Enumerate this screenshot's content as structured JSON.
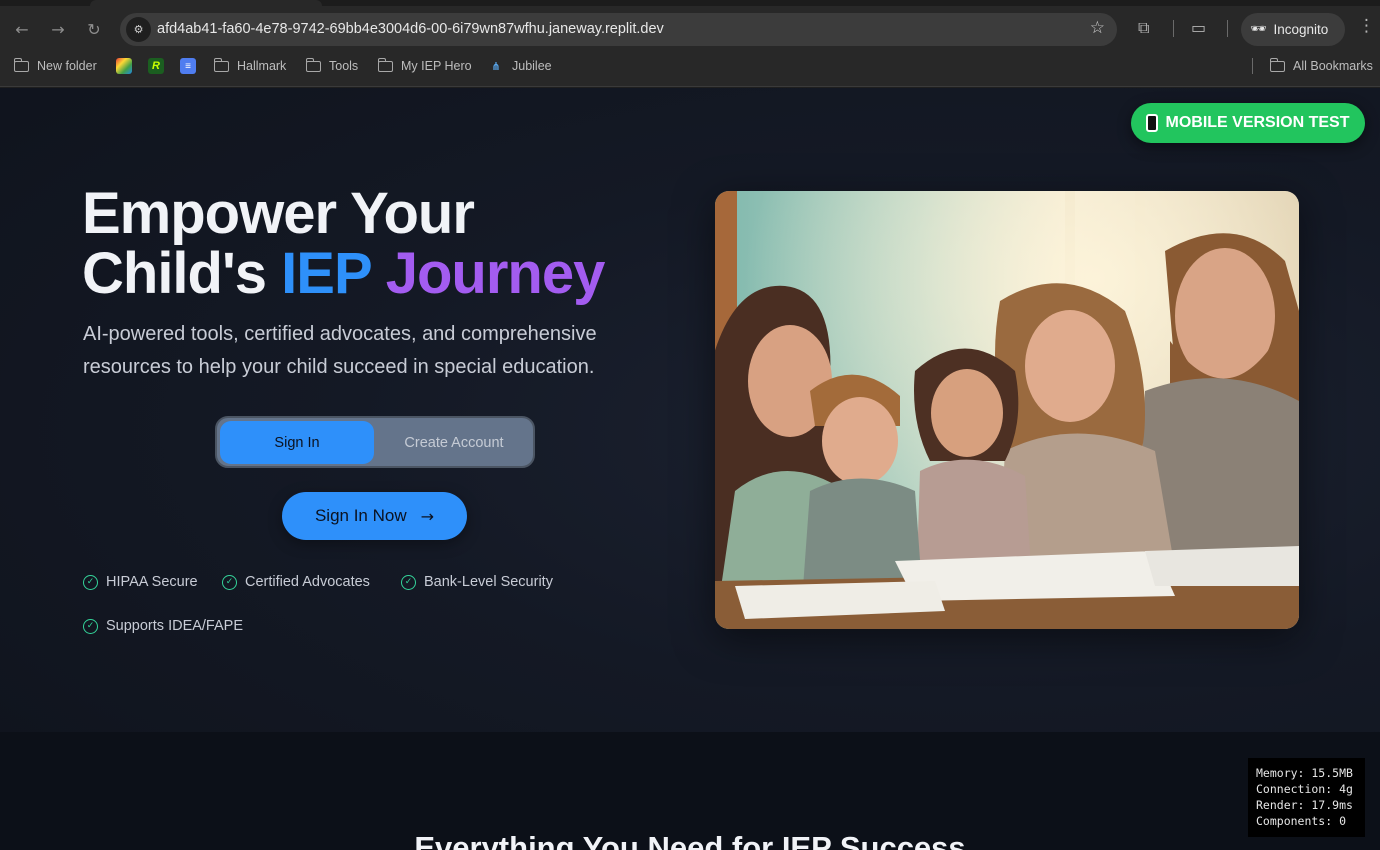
{
  "browser": {
    "url": "afd4ab41-fa60-4e78-9742-69bb4e3004d6-00-6i79wn87wfhu.janeway.replit.dev",
    "profile_label": "Incognito",
    "bookmarks": [
      "New folder",
      "Hallmark",
      "Tools",
      "My IEP Hero",
      "Jubilee"
    ],
    "all_bookmarks_label": "All Bookmarks"
  },
  "page": {
    "mobile_button": "MOBILE VERSION TEST",
    "hero": {
      "title_line1": "Empower Your",
      "title_line2_prefix": "Child's ",
      "title_highlight_blue": "IEP",
      "title_highlight_purple": "Journey",
      "subtitle": "AI-powered tools, certified advocates, and comprehensive resources to help your child succeed in special education."
    },
    "auth_toggle": {
      "active": "Sign In",
      "inactive": "Create Account"
    },
    "cta_label": "Sign In Now",
    "features": [
      "HIPAA Secure",
      "Certified Advocates",
      "Bank-Level Security",
      "Supports IDEA/FAPE"
    ],
    "section_title": "Everything You Need for IEP Success",
    "perf": {
      "memory": "Memory: 15.5MB",
      "connection": "Connection: 4g",
      "render": "Render: 17.9ms",
      "components": "Components: 0"
    },
    "colors": {
      "accent_blue": "#2e90fa",
      "accent_purple": "#a35cf0",
      "success_green": "#22c55e"
    }
  }
}
